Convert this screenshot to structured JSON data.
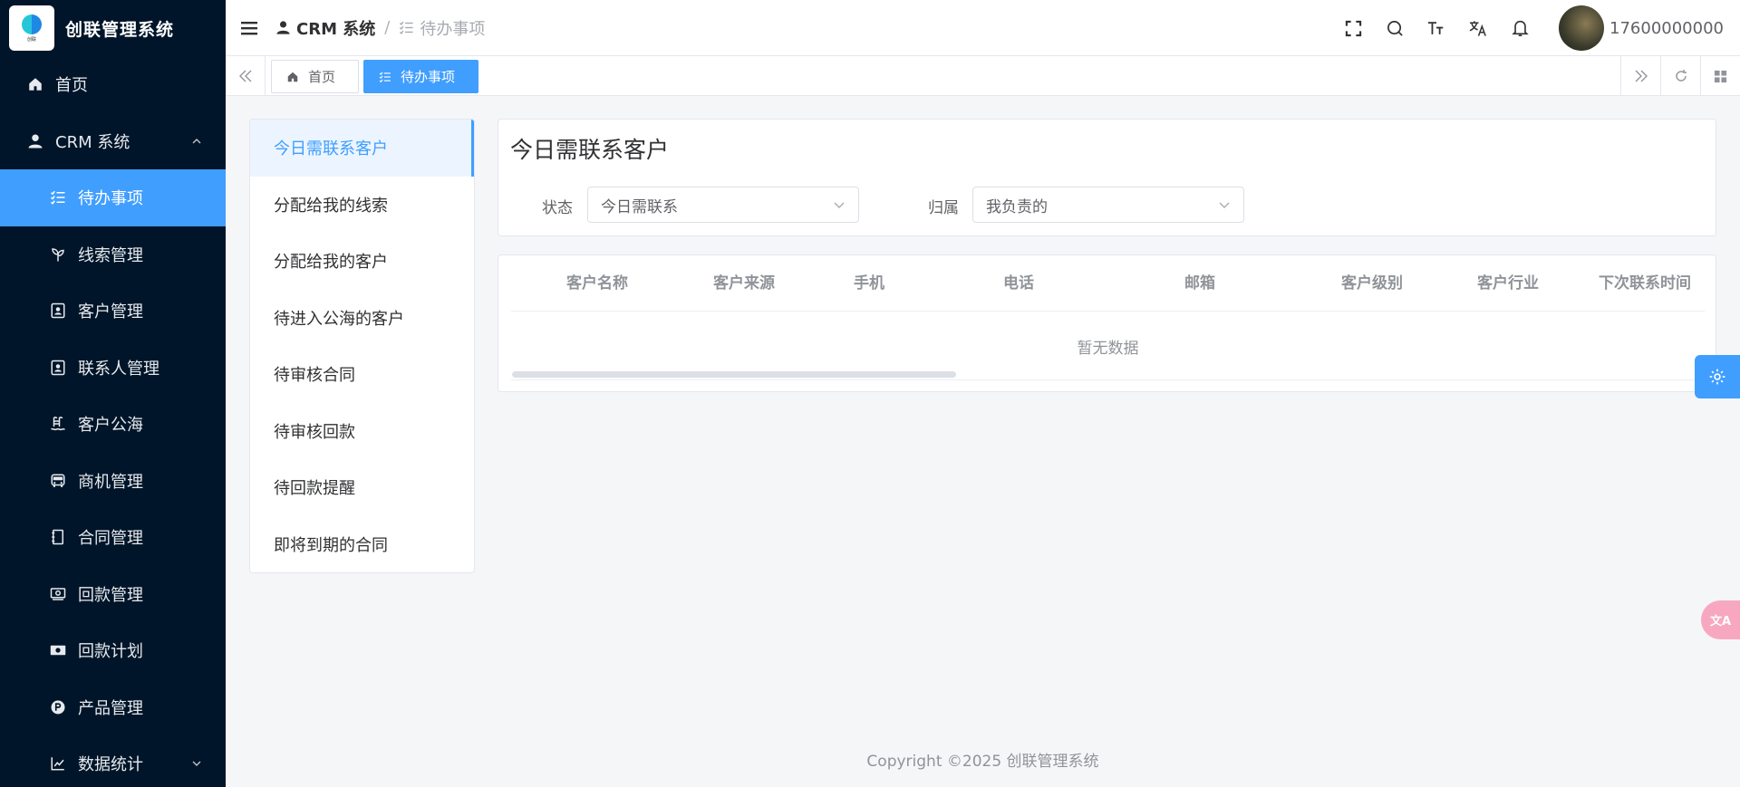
{
  "app": {
    "title": "创联管理系统",
    "logo_caption": "创联"
  },
  "sidebar": {
    "items": [
      {
        "label": "首页",
        "icon": "home-icon"
      },
      {
        "label": "CRM 系统",
        "icon": "user-icon",
        "expanded": true
      },
      {
        "label": "待办事项",
        "icon": "checklist-icon",
        "active": true
      },
      {
        "label": "线索管理",
        "icon": "leaf-icon"
      },
      {
        "label": "客户管理",
        "icon": "contact-card-icon"
      },
      {
        "label": "联系人管理",
        "icon": "contact-card-icon"
      },
      {
        "label": "客户公海",
        "icon": "pool-icon"
      },
      {
        "label": "商机管理",
        "icon": "bus-icon"
      },
      {
        "label": "合同管理",
        "icon": "notebook-icon"
      },
      {
        "label": "回款管理",
        "icon": "money-icon"
      },
      {
        "label": "回款计划",
        "icon": "cash-icon"
      },
      {
        "label": "产品管理",
        "icon": "product-p-icon"
      },
      {
        "label": "数据统计",
        "icon": "chart-icon"
      }
    ]
  },
  "header": {
    "breadcrumb": {
      "root": "CRM 系统",
      "separator": "/",
      "current": "待办事项"
    },
    "username": "17600000000"
  },
  "tabs": [
    {
      "label": "首页",
      "icon": "home-icon"
    },
    {
      "label": "待办事项",
      "icon": "checklist-icon",
      "active": true
    }
  ],
  "todo_menu": {
    "items": [
      {
        "label": "今日需联系客户",
        "active": true
      },
      {
        "label": "分配给我的线索"
      },
      {
        "label": "分配给我的客户"
      },
      {
        "label": "待进入公海的客户"
      },
      {
        "label": "待审核合同"
      },
      {
        "label": "待审核回款"
      },
      {
        "label": "待回款提醒"
      },
      {
        "label": "即将到期的合同"
      }
    ]
  },
  "filter": {
    "title": "今日需联系客户",
    "status_label": "状态",
    "status_value": "今日需联系",
    "owner_label": "归属",
    "owner_value": "我负责的"
  },
  "table": {
    "columns": [
      "客户名称",
      "客户来源",
      "手机",
      "电话",
      "邮箱",
      "客户级别",
      "客户行业",
      "下次联系时间"
    ],
    "empty_text": "暂无数据"
  },
  "footer": {
    "copyright": "Copyright ©2025 创联管理系统"
  },
  "floating": {
    "translate_label": "文A"
  },
  "colors": {
    "primary": "#409eff",
    "sidebar_bg": "#001529"
  }
}
